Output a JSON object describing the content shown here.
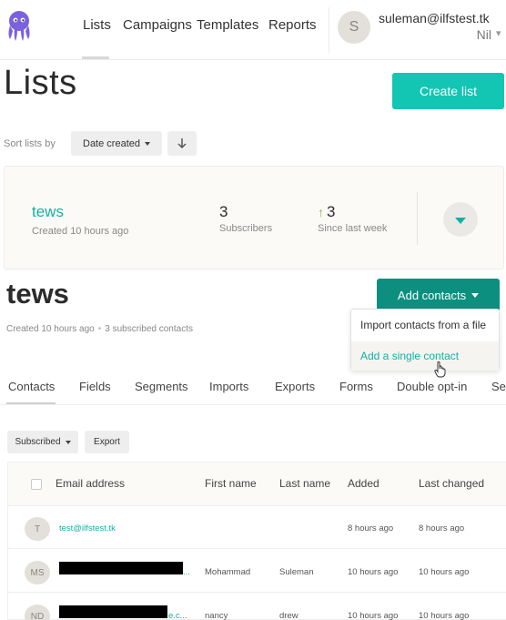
{
  "nav": {
    "items": [
      "Lists",
      "Campaigns",
      "Templates",
      "Reports"
    ],
    "user_initial": "S",
    "user_email": "suleman@ilfstest.tk",
    "user_org": "Nil"
  },
  "page": {
    "title": "Lists",
    "create_button": "Create list",
    "sort_label": "Sort lists by",
    "sort_value": "Date created"
  },
  "list_card": {
    "name": "tews",
    "created": "Created 10 hours ago",
    "subscribers_value": "3",
    "subscribers_label": "Subscribers",
    "weekly_value": "3",
    "weekly_label": "Since last week"
  },
  "detail": {
    "title": "tews",
    "created": "Created 10 hours ago",
    "subscribed": "3 subscribed contacts",
    "add_contacts": "Add contacts",
    "menu": [
      "Import contacts from a file",
      "Add a single contact"
    ]
  },
  "tabs": [
    "Contacts",
    "Fields",
    "Segments",
    "Imports",
    "Exports",
    "Forms",
    "Double opt-in",
    "Se"
  ],
  "filters": {
    "status": "Subscribed",
    "export": "Export"
  },
  "table": {
    "headers": [
      "Email address",
      "First name",
      "Last name",
      "Added",
      "Last changed"
    ],
    "rows": [
      {
        "initials": "T",
        "email": "test@ilfstest.tk",
        "first": "",
        "last": "",
        "added": "8 hours ago",
        "changed": "8 hours ago"
      },
      {
        "initials": "MS",
        "email": "...",
        "first": "Mohammad",
        "last": "Suleman",
        "added": "10 hours ago",
        "changed": "10 hours ago"
      },
      {
        "initials": "ND",
        "email": "e.c...",
        "first": "nancy",
        "last": "drew",
        "added": "10 hours ago",
        "changed": "10 hours ago"
      }
    ]
  },
  "colors": {
    "brand_teal": "#13c5b3",
    "dark_teal": "#0d8f7f",
    "link_teal": "#13b1a2",
    "up_arrow_green": "#7dbb35",
    "logo_purple": "#7b61e0"
  },
  "icons": [
    "octopus-logo",
    "chevron-down-icon",
    "arrow-down-icon",
    "arrow-up-icon",
    "hand-pointer-cursor"
  ]
}
